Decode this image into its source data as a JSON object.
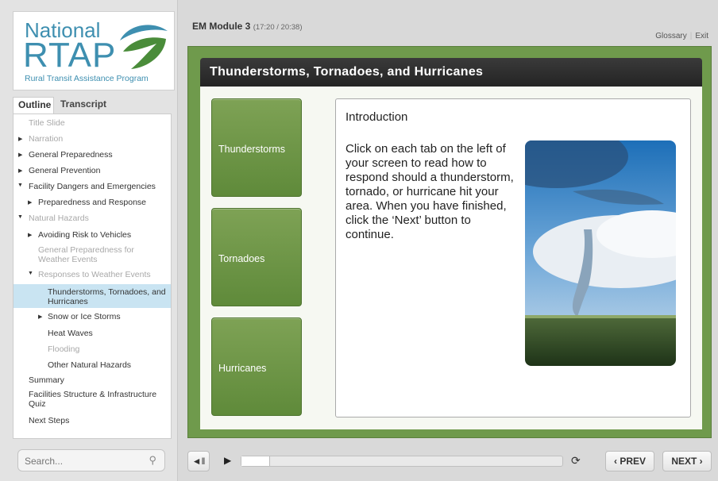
{
  "logo": {
    "line1": "National",
    "line2": "RTAP",
    "tagline": "Rural Transit Assistance Program",
    "colors": {
      "blue": "#3e8fb0",
      "green": "#4a8c3a"
    }
  },
  "sidebar": {
    "tabs": [
      "Outline",
      "Transcript"
    ],
    "outline": [
      {
        "label": "Title Slide",
        "state": "dim"
      },
      {
        "label": "Narration",
        "state": "dim",
        "arrow": "right"
      },
      {
        "label": "General Preparedness",
        "arrow": "right"
      },
      {
        "label": "General Prevention",
        "arrow": "right"
      },
      {
        "label": "Facility Dangers and Emergencies",
        "arrow": "down"
      },
      {
        "label": "Preparedness and Response",
        "arrow": "right"
      },
      {
        "label": "Natural Hazards",
        "state": "dim",
        "arrow": "down"
      },
      {
        "label": "Avoiding Risk to Vehicles",
        "arrow": "right"
      },
      {
        "label": "General Preparedness for Weather Events",
        "state": "dim"
      },
      {
        "label": "Responses to Weather Events",
        "state": "dim",
        "arrow": "down"
      },
      {
        "label": "Thunderstorms, Tornadoes, and Hurricanes",
        "state": "selected"
      },
      {
        "label": "Snow or Ice Storms",
        "arrow": "right"
      },
      {
        "label": "Heat Waves"
      },
      {
        "label": "Flooding",
        "state": "dim"
      },
      {
        "label": "Other Natural Hazards"
      },
      {
        "label": "Summary"
      },
      {
        "label": "Facilities Structure & Infrastructure Quiz"
      },
      {
        "label": "Next Steps"
      }
    ],
    "search": {
      "placeholder": "Search...",
      "icon": "search-icon"
    }
  },
  "header": {
    "module": "EM Module 3",
    "time": "(17:20 / 20:38)",
    "links": [
      "Glossary",
      "Exit"
    ]
  },
  "slide": {
    "title": "Thunderstorms, Tornadoes, and Hurricanes",
    "tabs": [
      "Thunderstorms",
      "Tornadoes",
      "Hurricanes"
    ],
    "content_heading": "Introduction",
    "content_text": "Click on each tab on the left of your screen to read how to respond should a thunderstorm, tornado, or hurricane hit your area. When you have finished, click the ‘Next’ button to continue.",
    "image": "tornado-photo",
    "colors": {
      "stage": "#6f9a4c",
      "tab": "#6a9444"
    }
  },
  "player": {
    "progress": 0.09,
    "prev_label": "PREV",
    "next_label": "NEXT",
    "icons": [
      "volume-icon",
      "play-icon",
      "restart-icon"
    ]
  }
}
